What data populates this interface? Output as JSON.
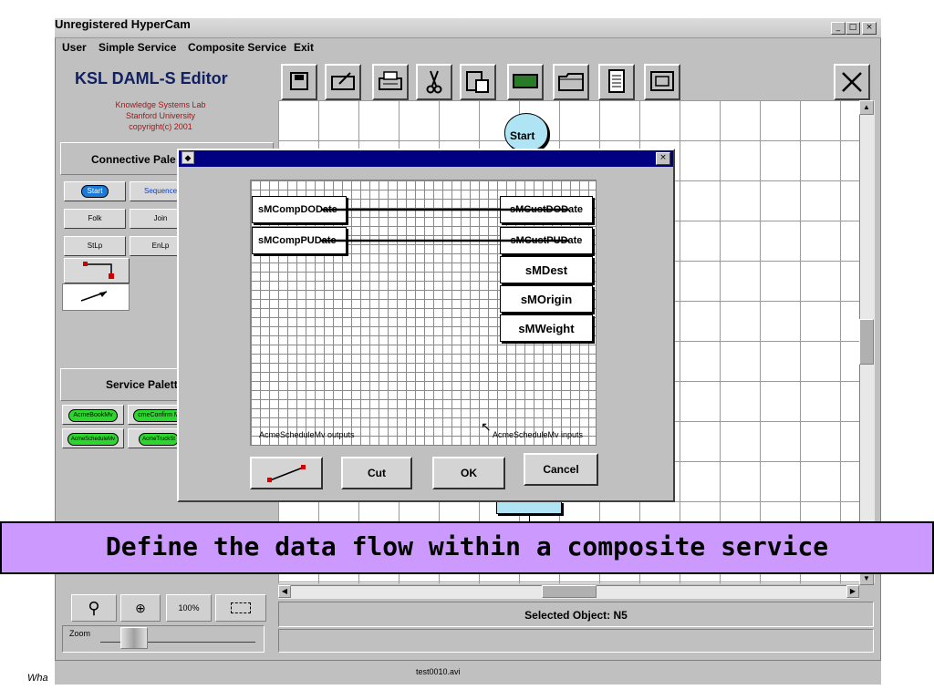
{
  "window": {
    "title": "Unregistered HyperCam",
    "min_glyph": "_",
    "max_glyph": "□",
    "close_glyph": "×"
  },
  "menu": [
    "User",
    "Simple Service",
    "Composite Service",
    "Exit"
  ],
  "header": {
    "app_title": "KSL DAML-S Editor",
    "org_line1": "Knowledge Systems Lab",
    "org_line2": "Stanford University",
    "org_line3": "copyright(c) 2001"
  },
  "connective_palette": {
    "title": "Connective Pale",
    "items": [
      "Start",
      "Sequence",
      "Folk",
      "Join",
      "StLp",
      "EnLp"
    ]
  },
  "service_palette": {
    "title": "Service Palett",
    "items": [
      "AcmeBookMv",
      "cmeConfirm M",
      "AcmeScheduleMv",
      "AcmeTruckSt"
    ]
  },
  "zoom": {
    "percent_label": "100%",
    "label": "Zoom"
  },
  "canvas": {
    "start_label": "Start"
  },
  "status": {
    "selected_object": "Selected Object:  N5"
  },
  "footer": {
    "left_text": "Wha",
    "video_file": "test0010.avi"
  },
  "dialog": {
    "outputs": [
      "sMCompDODate",
      "sMCompPUDate"
    ],
    "inputs": [
      "sMCustDODate",
      "sMCustPUDate",
      "sMDest",
      "sMOrigin",
      "sMWeight"
    ],
    "outputs_label": "AcmeScheduleMv outputs",
    "inputs_label": "AcmeScheduleMv inputs",
    "buttons": {
      "cut": "Cut",
      "ok": "OK",
      "cancel": "Cancel"
    },
    "close_glyph": "×"
  },
  "caption": "Define the data flow within a composite service",
  "colors": {
    "caption_bg": "#cc99ff",
    "dialog_title": "#000080",
    "start_node": "#aee4f4"
  }
}
